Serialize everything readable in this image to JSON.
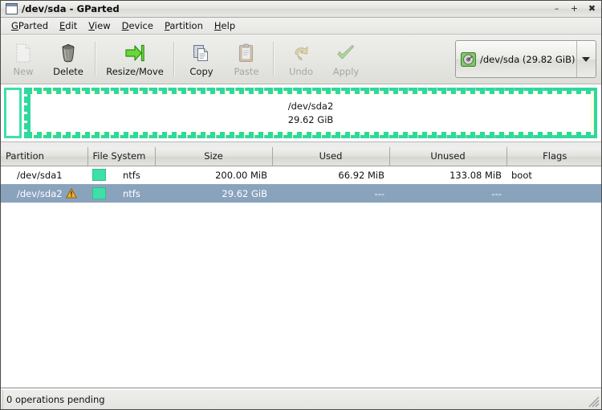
{
  "window": {
    "title": "/dev/sda - GParted",
    "icon": "window-icon",
    "controls": [
      {
        "name": "minimize-button",
        "glyph": "–"
      },
      {
        "name": "maximize-button",
        "glyph": "+"
      },
      {
        "name": "close-button",
        "glyph": "✖"
      }
    ]
  },
  "menubar": {
    "items": [
      {
        "label": "GParted",
        "mnemonic": "G"
      },
      {
        "label": "Edit",
        "mnemonic": "E"
      },
      {
        "label": "View",
        "mnemonic": "V"
      },
      {
        "label": "Device",
        "mnemonic": "D"
      },
      {
        "label": "Partition",
        "mnemonic": "P"
      },
      {
        "label": "Help",
        "mnemonic": "H"
      }
    ]
  },
  "toolbar": {
    "new_label": "New",
    "delete_label": "Delete",
    "resize_move_label": "Resize/Move",
    "copy_label": "Copy",
    "paste_label": "Paste",
    "undo_label": "Undo",
    "apply_label": "Apply",
    "device_combo": {
      "text": "/dev/sda   (29.82 GiB)",
      "icon": "harddisk-icon"
    }
  },
  "diskview": {
    "partitions": [
      {
        "name": "/dev/sda1",
        "size": "200.00 MiB",
        "selected": false,
        "color": "#3fe0a8"
      },
      {
        "name": "/dev/sda2",
        "size": "29.62 GiB",
        "selected": true,
        "color": "#3fe0a8"
      }
    ],
    "selected_label_line1": "/dev/sda2",
    "selected_label_line2": "29.62 GiB"
  },
  "table": {
    "columns": [
      "Partition",
      "File System",
      "Size",
      "Used",
      "Unused",
      "Flags"
    ],
    "rows": [
      {
        "partition": "/dev/sda1",
        "warning": false,
        "filesystem": "ntfs",
        "fs_color": "#3fe0a8",
        "size": "200.00 MiB",
        "used": "66.92 MiB",
        "unused": "133.08 MiB",
        "flags": "boot",
        "selected": false
      },
      {
        "partition": "/dev/sda2",
        "warning": true,
        "filesystem": "ntfs",
        "fs_color": "#3fe0a8",
        "size": "29.62 GiB",
        "used": "---",
        "unused": "---",
        "flags": "",
        "selected": true
      }
    ]
  },
  "statusbar": {
    "text": "0 operations pending"
  },
  "colors": {
    "selection_blue": "#8aa3bd",
    "partition_green": "#3fe0a8",
    "marching_ants": "#2ed8a0",
    "warning_yellow": "#f5b32b"
  }
}
